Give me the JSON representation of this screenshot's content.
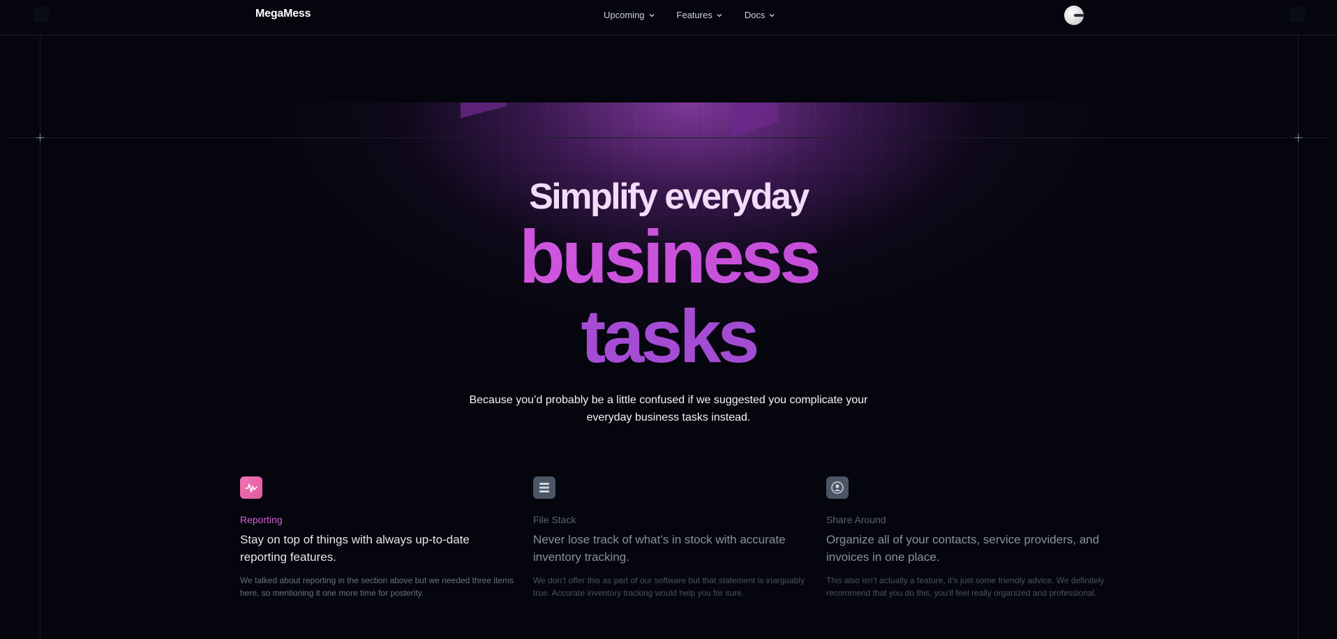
{
  "brand": "MegaMess",
  "nav": {
    "items": [
      {
        "label": "Upcoming"
      },
      {
        "label": "Features"
      },
      {
        "label": "Docs"
      }
    ]
  },
  "hero": {
    "line1": "Simplify everyday",
    "line2": "business",
    "line3": "tasks",
    "subtitle": "Because you’d probably be a little confused if we suggested you complicate your everyday business tasks instead."
  },
  "features": [
    {
      "icon": "activity-icon",
      "title": "Reporting",
      "headline": "Stay on top of things with always up-to-date reporting features.",
      "description": "We talked about reporting in the section above but we needed three items here, so mentioning it one more time for posterity."
    },
    {
      "icon": "stack-icon",
      "title": "File Stack",
      "headline": "Never lose track of what’s in stock with accurate inventory tracking.",
      "description": "We don’t offer this as part of our software but that statement is inarguably true. Accurate inventory tracking would help you for sure."
    },
    {
      "icon": "contact-icon",
      "title": "Share Around",
      "headline": "Organize all of your contacts, service providers, and invoices in one place.",
      "description": "This also isn’t actually a feature, it’s just some friendly advice. We definitely recommend that you do this, you’ll feel really organized and professional."
    }
  ],
  "colors": {
    "background": "#05060d",
    "accent_pink": "#e35fe6",
    "accent_purple": "#9a48d0",
    "reporting_title": "#d65fd8"
  }
}
